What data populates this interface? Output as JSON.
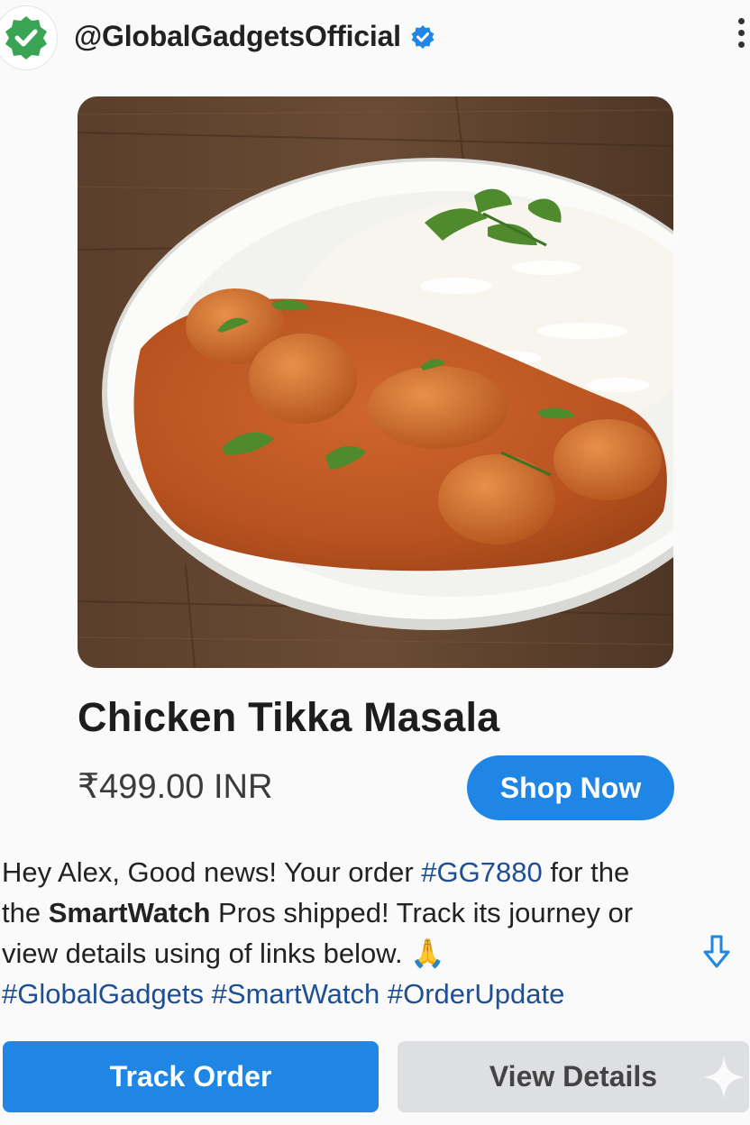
{
  "header": {
    "handle": "@GlobalGadgetsOfficial",
    "avatar_icon": "verified-check-badge-icon",
    "verified_icon": "verified-badge-icon",
    "menu_icon": "more-vertical-icon",
    "accent": "#1f86e6"
  },
  "product": {
    "image_icon": "food-photo",
    "title": "Chicken Tikka Masala",
    "price": "₹499.00 INR",
    "shop_label": "Shop Now"
  },
  "caption": {
    "line1_pre": "Hey Alex, Good news! Your order ",
    "order_tag": "#GG7880",
    "line1_post": " for the",
    "line2_pre": "the ",
    "line2_bold": "SmartWatch",
    "line2_post": " Pros shipped! Track its journey or",
    "line3": "view details using of links below.",
    "emoji": "🙏",
    "hashtags": "#GlobalGadgets #SmartWatch #OrderUpdate",
    "down_icon": "arrow-down-icon"
  },
  "actions": {
    "track_label": "Track Order",
    "view_label": "View Details",
    "sparkle_icon": "sparkle-icon"
  }
}
